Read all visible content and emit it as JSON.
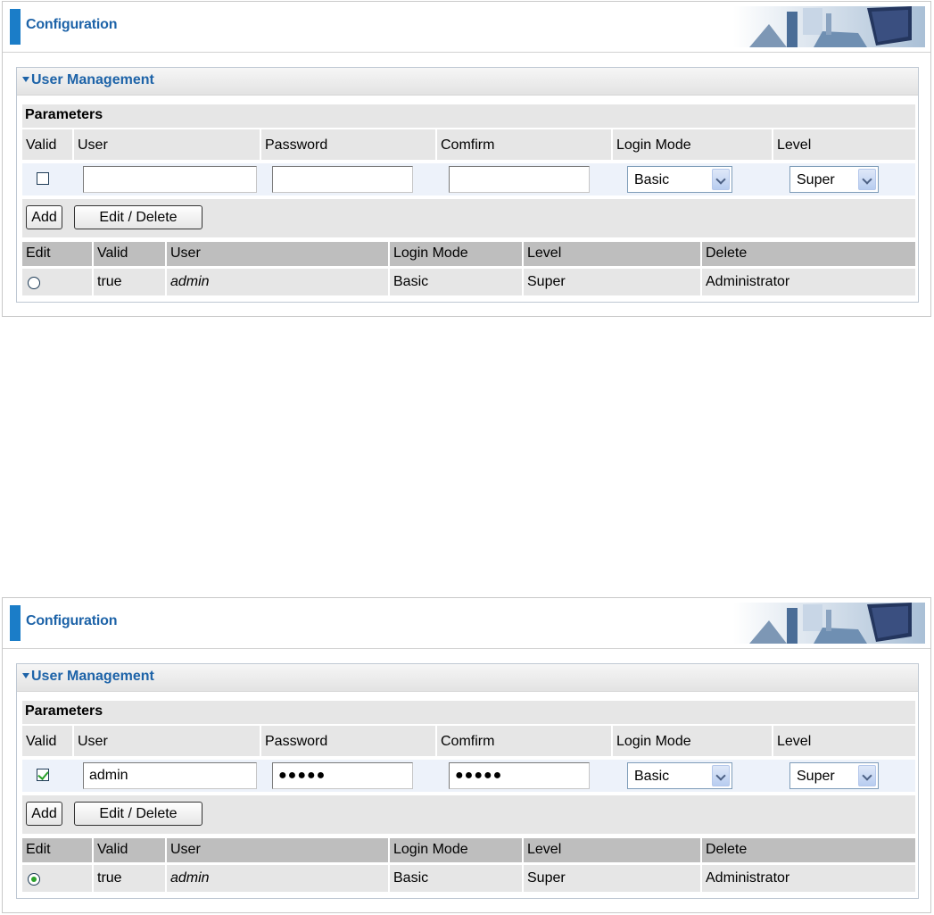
{
  "screens": [
    {
      "header": {
        "title": "Configuration"
      },
      "panel": {
        "title": "User Management",
        "parameters_label": "Parameters",
        "columns": {
          "valid": "Valid",
          "user": "User",
          "password": "Password",
          "confirm": "Comfirm",
          "login_mode": "Login Mode",
          "level": "Level"
        },
        "form": {
          "valid_checked": false,
          "user": "",
          "password": "",
          "confirm": "",
          "login_mode": "Basic",
          "level": "Super"
        },
        "buttons": {
          "add": "Add",
          "edit_delete": "Edit / Delete"
        },
        "list_columns": {
          "edit": "Edit",
          "valid": "Valid",
          "user": "User",
          "login_mode": "Login Mode",
          "level": "Level",
          "delete": "Delete"
        },
        "rows": [
          {
            "selected": false,
            "valid": "true",
            "user": "admin",
            "login_mode": "Basic",
            "level": "Super",
            "delete": "Administrator"
          }
        ]
      }
    },
    {
      "header": {
        "title": "Configuration"
      },
      "panel": {
        "title": "User Management",
        "parameters_label": "Parameters",
        "columns": {
          "valid": "Valid",
          "user": "User",
          "password": "Password",
          "confirm": "Comfirm",
          "login_mode": "Login Mode",
          "level": "Level"
        },
        "form": {
          "valid_checked": true,
          "user": "admin",
          "password": "●●●●●",
          "confirm": "●●●●●",
          "login_mode": "Basic",
          "level": "Super"
        },
        "buttons": {
          "add": "Add",
          "edit_delete": "Edit / Delete"
        },
        "list_columns": {
          "edit": "Edit",
          "valid": "Valid",
          "user": "User",
          "login_mode": "Login Mode",
          "level": "Level",
          "delete": "Delete"
        },
        "rows": [
          {
            "selected": true,
            "valid": "true",
            "user": "admin",
            "login_mode": "Basic",
            "level": "Super",
            "delete": "Administrator"
          }
        ]
      }
    }
  ],
  "colors": {
    "accent": "#1d63a8",
    "header_bar": "#1b7dc8",
    "check": "#2ba12b"
  }
}
